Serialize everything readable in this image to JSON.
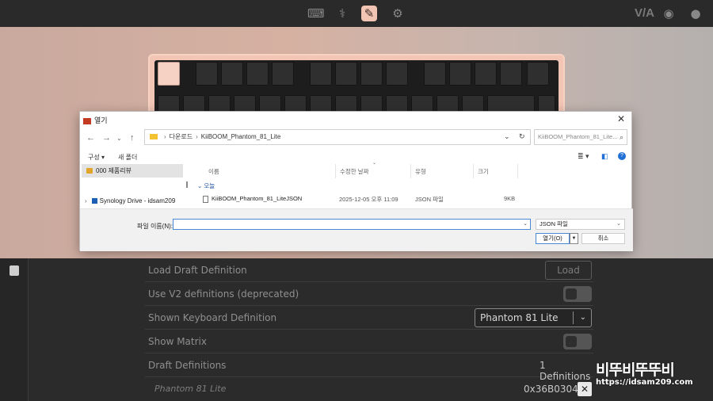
{
  "toolbar": {
    "icons": [
      "keyboard-icon",
      "stethoscope-icon",
      "brush-icon",
      "gear-icon"
    ],
    "active": "brush-icon",
    "right_text": "V/A",
    "right_icons": [
      "discord-icon",
      "github-icon"
    ]
  },
  "dialog": {
    "title": "열기",
    "close": "✕",
    "address": {
      "chevron": "›",
      "segments": [
        "다운로드",
        "KiiBOOM_Phantom_81_Lite"
      ]
    },
    "search_placeholder": "KiiBOOM_Phantom_81_Lite...",
    "commands": {
      "organize": "구성 ▾",
      "new_folder": "새 폴더"
    },
    "nav": {
      "selected": "000 제품리뷰",
      "item": "Synology Drive - idsam209"
    },
    "columns": {
      "name": "이름",
      "modified": "수정한 날짜",
      "type": "유형",
      "size": "크기"
    },
    "group": "오늘",
    "file": {
      "name": "KiiBOOM_Phantom_81_LiteJSON",
      "modified": "2025-12-05 오후 11:09",
      "type": "JSON 파일",
      "size": "9KB"
    },
    "filename_label": "파일 이름(N):",
    "filename_value": "",
    "filetype": "JSON 파일",
    "open_button": "열기(O)",
    "cancel_button": "취소"
  },
  "settings": {
    "rows": [
      {
        "label": "Load Draft Definition",
        "button": "Load"
      },
      {
        "label": "Use V2 definitions (deprecated)",
        "toggle": false
      },
      {
        "label": "Shown Keyboard Definition",
        "select": "Phantom 81 Lite"
      },
      {
        "label": "Show Matrix",
        "toggle": false
      },
      {
        "label": "Draft Definitions",
        "value": "1 Definitions"
      },
      {
        "label": "Phantom 81 Lite",
        "value": "0x36B03048",
        "remove": "✕"
      }
    ]
  },
  "watermark": {
    "line1": "비뚜비뚜뚜비",
    "line2": "https://idsam209.com"
  },
  "colors": {
    "accent": "#f2c4b4",
    "dialog_accent": "#4a88d4"
  }
}
